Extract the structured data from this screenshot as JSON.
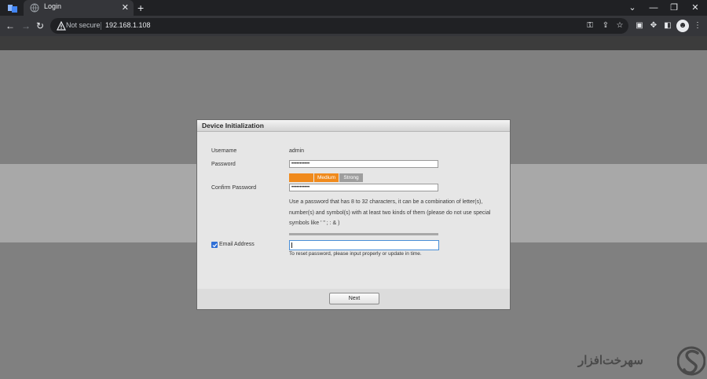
{
  "browser": {
    "tab_title": "Login",
    "tab_close": "✕",
    "new_tab": "+",
    "window_controls": [
      "⌄",
      "—",
      "❐",
      "✕"
    ],
    "security_label": "Not secure",
    "url": "192.168.1.108"
  },
  "dialog": {
    "title": "Device Initialization",
    "username_label": "Username",
    "username_value": "admin",
    "password_label": "Password",
    "password_value": "•••••••••••",
    "confirm_label": "Confirm Password",
    "confirm_value": "•••••••••••",
    "strength": {
      "weak_label": "",
      "medium_label": "Medium",
      "strong_label": "Strong",
      "active_color": "#f08a1c",
      "inactive_color": "#9e9e9e"
    },
    "password_hint": "Use a password that has 8 to 32 characters, it can be a combination of letter(s), number(s) and symbol(s) with at least two kinds of them (please do not use special symbols like ' \" ; : & )",
    "email_checked": true,
    "email_label": "Email Address",
    "email_value": "",
    "email_hint": "To reset password, please input properly or update in time.",
    "next_button": "Next"
  },
  "watermark": {
    "text": "ﺳﻬﺮﺧﺖﺍﻓﺰﺍﺭ"
  },
  "colors": {
    "chrome_dark": "#202124",
    "chrome_toolbar": "#35363a",
    "page_bg": "#808080",
    "accent_blue": "#2f6fd6"
  }
}
